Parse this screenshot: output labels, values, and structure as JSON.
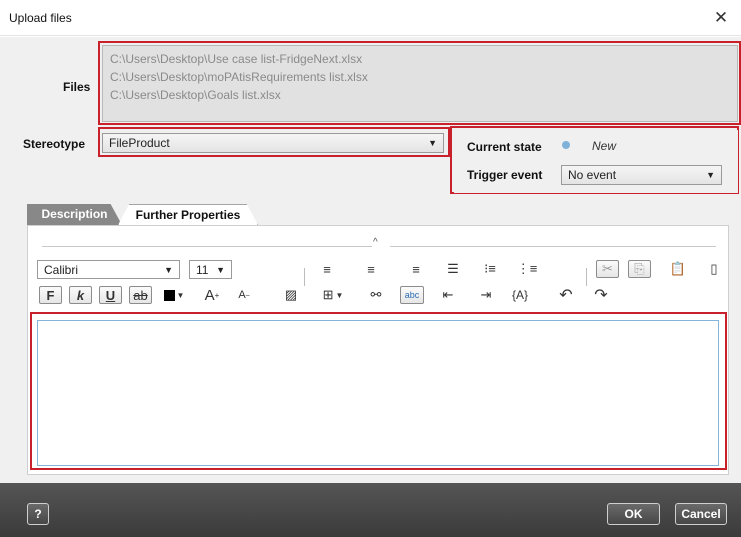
{
  "window": {
    "title": "Upload files"
  },
  "labels": {
    "files": "Files",
    "stereotype": "Stereotype",
    "current_state": "Current state",
    "trigger_event": "Trigger event"
  },
  "files": [
    "C:\\Users\\Desktop\\Use case list-FridgeNext.xlsx",
    "C:\\Users\\Desktop\\moPAtisRequirements list.xlsx",
    "C:\\Users\\Desktop\\Goals list.xlsx"
  ],
  "stereotype": {
    "value": "FileProduct"
  },
  "state": {
    "value": "New",
    "dot_color": "#7fb1d9"
  },
  "trigger": {
    "value": "No event"
  },
  "tabs": [
    "Description",
    "Further Properties"
  ],
  "toolbar": {
    "font": "Calibri",
    "size": "11",
    "bold": "F",
    "italic": "k",
    "underline": "U",
    "strike": "ab",
    "variable": "{A}",
    "spellcheck": "abc"
  },
  "footer": {
    "help": "?",
    "ok": "OK",
    "cancel": "Cancel"
  },
  "colors": {
    "highlight": "#c9212b",
    "footer": "#444444",
    "active_tab": "#888888"
  }
}
